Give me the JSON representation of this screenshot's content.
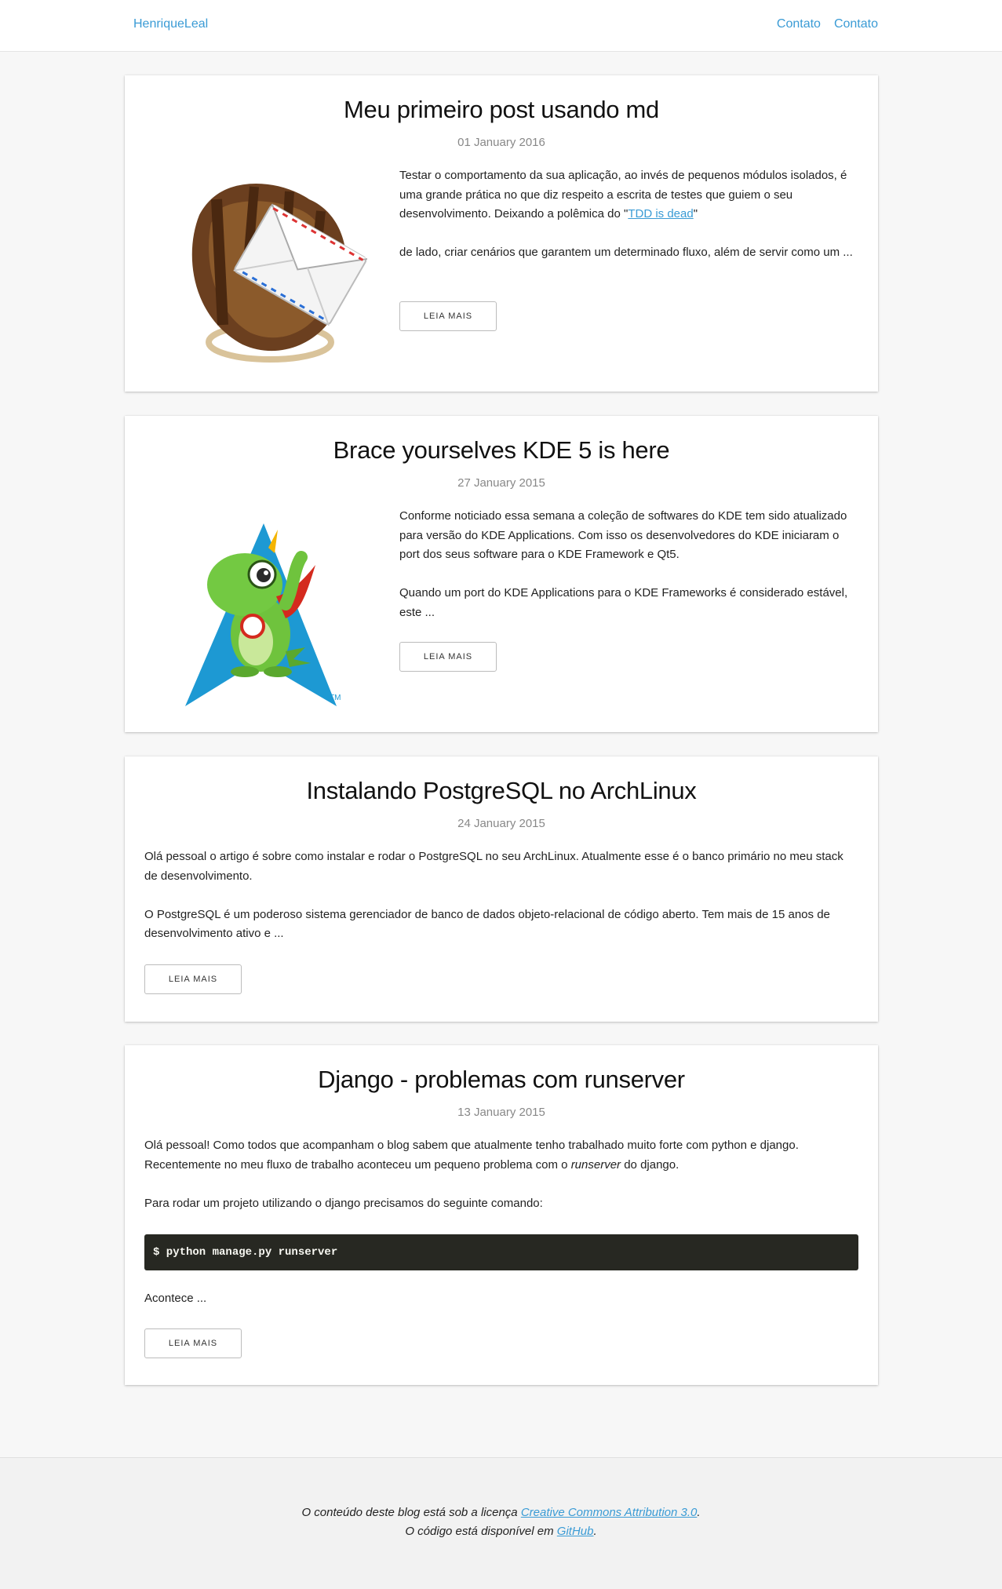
{
  "nav": {
    "brand": "HenriqueLeal",
    "links": [
      "Contato",
      "Contato"
    ]
  },
  "posts": [
    {
      "title": "Meu primeiro post usando md",
      "date": "01 January 2016",
      "image": "mail-catcher-glove-icon",
      "p1_pre": "Testar o comportamento da sua aplicação, ao invés de pequenos módulos isolados, é uma grande prática no que diz respeito a escrita de testes que guiem o seu desenvolvimento. Deixando a polêmica do \"",
      "p1_link": "TDD is dead",
      "p1_post": "\"",
      "p2": "de lado, criar cenários que garantem um determinado fluxo, além de servir como um ...",
      "button": "LEIA MAIS"
    },
    {
      "title": "Brace yourselves KDE 5 is here",
      "date": "27 January 2015",
      "image": "kde-konqi-dragon-icon",
      "p1": "Conforme noticiado essa semana a coleção de softwares do KDE tem sido atualizado para versão do KDE Applications. Com isso os desenvolvedores do KDE iniciaram o port dos seus software para o KDE Framework e Qt5.",
      "p2": "Quando um port do KDE Applications para o KDE Frameworks é considerado estável, este ...",
      "tm": "TM",
      "button": "LEIA MAIS"
    },
    {
      "title": "Instalando PostgreSQL no ArchLinux",
      "date": "24 January 2015",
      "p1": "Olá pessoal o artigo é sobre como instalar e rodar o PostgreSQL no seu ArchLinux. Atualmente esse é o banco primário no meu stack de desenvolvimento.",
      "p2": "O PostgreSQL é um poderoso sistema gerenciador de banco de dados objeto-relacional de código aberto. Tem mais de 15 anos de desenvolvimento ativo e ...",
      "button": "LEIA MAIS"
    },
    {
      "title": "Django - problemas com runserver",
      "date": "13 January 2015",
      "p1_pre": "Olá pessoal! Como todos que acompanham o blog sabem que atualmente tenho trabalhado muito forte com python e django. Recentemente no meu fluxo de trabalho aconteceu um pequeno problema com o ",
      "p1_em": "runserver",
      "p1_post": " do django.",
      "p2": "Para rodar um projeto utilizando o django precisamos do seguinte comando:",
      "code": "$ python manage.py runserver",
      "p3": "Acontece ...",
      "button": "LEIA MAIS"
    }
  ],
  "footer": {
    "line1_pre": "O conteúdo deste blog está sob a licença ",
    "line1_link": "Creative Commons Attribution 3.0",
    "line1_post": ".",
    "line2_pre": "O código está disponível em ",
    "line2_link": "GitHub",
    "line2_post": "."
  },
  "colors": {
    "link": "#3a9bd5",
    "background": "#f7f7f7",
    "code_bg": "#272822"
  }
}
